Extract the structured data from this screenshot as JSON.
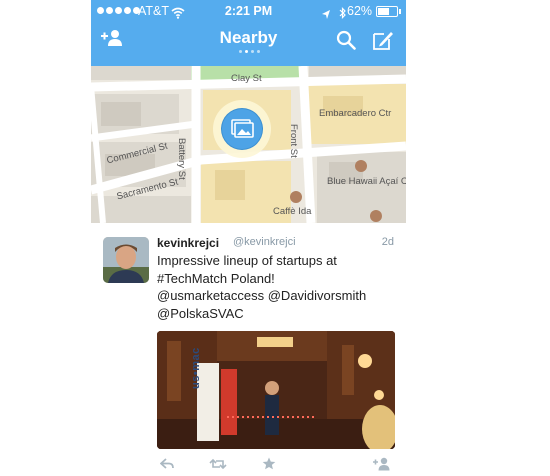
{
  "status_bar": {
    "carrier": "AT&T",
    "time": "2:21 PM",
    "battery_percent": "62%",
    "battery_level": 0.62
  },
  "nav": {
    "title": "Nearby",
    "page_count": 4,
    "active_page": 1
  },
  "map": {
    "streets": [
      "Clay St",
      "Battery St",
      "Front St",
      "Commercial St",
      "Sacramento St",
      "Embarcadero Ctr"
    ],
    "places": [
      "Blue Hawaii Açaí Café",
      "Caffè Ida"
    ]
  },
  "tweet": {
    "display_name": "kevinkrejci",
    "handle": "@kevinkrejci",
    "time_ago": "2d",
    "lines": [
      "Impressive lineup of startups at",
      "#TechMatch Poland!",
      "@usmarketaccess  @Davidivorsmith",
      "@PolskaSVAC"
    ],
    "photo_banner_text": "us•mac"
  },
  "colors": {
    "brand_blue": "#55acee",
    "pin_blue": "#4da3e6",
    "muted_text": "#8899a6"
  },
  "icons": {
    "add_user": "add-user-icon",
    "search": "search-icon",
    "compose": "compose-icon",
    "reply": "reply-icon",
    "retweet": "retweet-icon",
    "favorite": "star-icon",
    "follow": "follow-icon"
  }
}
